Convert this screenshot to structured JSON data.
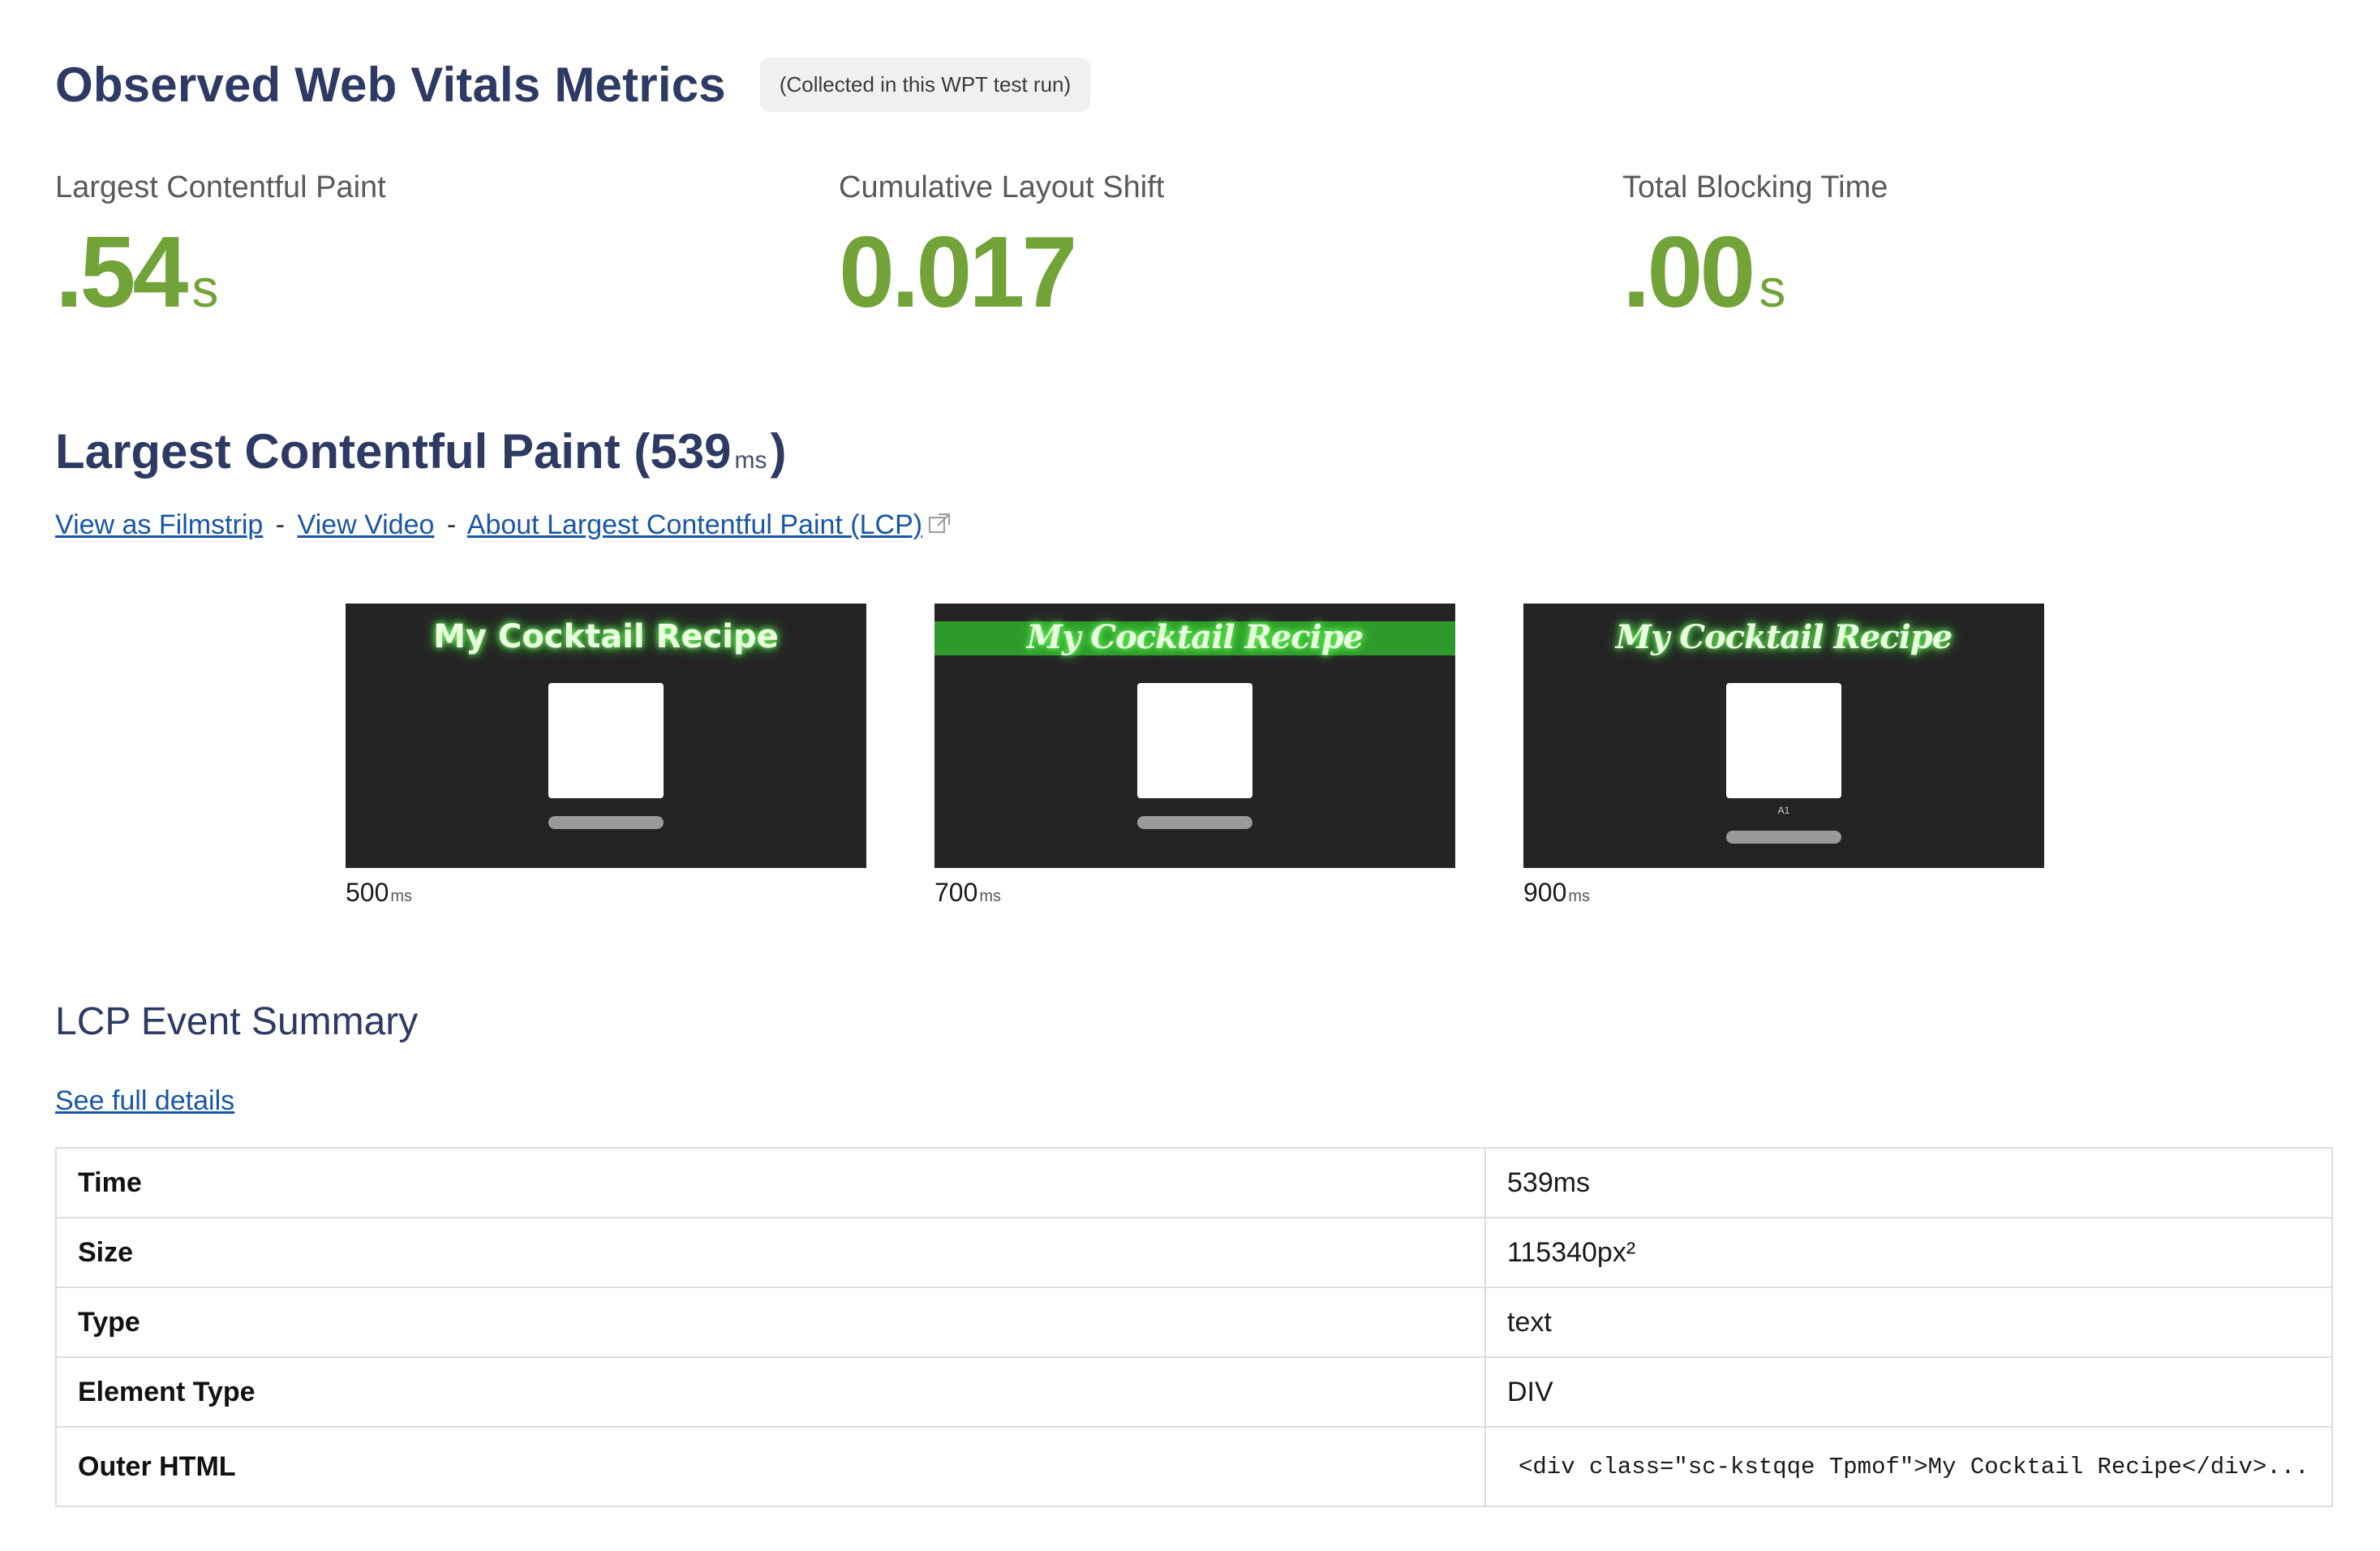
{
  "header": {
    "title": "Observed Web Vitals Metrics",
    "note": "(Collected in this WPT test run)"
  },
  "metrics": [
    {
      "label": "Largest Contentful Paint",
      "value": ".54",
      "unit": "s"
    },
    {
      "label": "Cumulative Layout Shift",
      "value": "0.017",
      "unit": ""
    },
    {
      "label": "Total Blocking Time",
      "value": ".00",
      "unit": "s"
    }
  ],
  "lcp": {
    "title_prefix": "Largest Contentful Paint (",
    "title_value": "539",
    "title_unit": "ms",
    "title_suffix": ")",
    "links": {
      "filmstrip": "View as Filmstrip",
      "video": "View Video",
      "about": "About Largest Contentful Paint (LCP)",
      "sep": "-"
    }
  },
  "frames": [
    {
      "page_title": "My Cocktail Recipe",
      "time": "500",
      "unit": "ms"
    },
    {
      "page_title": "My Cocktail Recipe",
      "time": "700",
      "unit": "ms"
    },
    {
      "page_title": "My Cocktail Recipe",
      "card_caption": "A1",
      "time": "900",
      "unit": "ms"
    }
  ],
  "summary": {
    "title": "LCP Event Summary",
    "details_link": "See full details",
    "rows": [
      {
        "key": "Time",
        "value": "539ms"
      },
      {
        "key": "Size",
        "value": "115340px²"
      },
      {
        "key": "Type",
        "value": "text"
      },
      {
        "key": "Element Type",
        "value": "DIV"
      },
      {
        "key": "Outer HTML",
        "value": "<div class=\"sc-kstqqe Tpmof\">My Cocktail Recipe</div>..."
      }
    ]
  },
  "colors": {
    "heading": "#2d3a63",
    "good_metric": "#72a339",
    "link": "#1a56a8",
    "thumb_bg": "#242424",
    "neon_green": "#2f9a2c"
  }
}
